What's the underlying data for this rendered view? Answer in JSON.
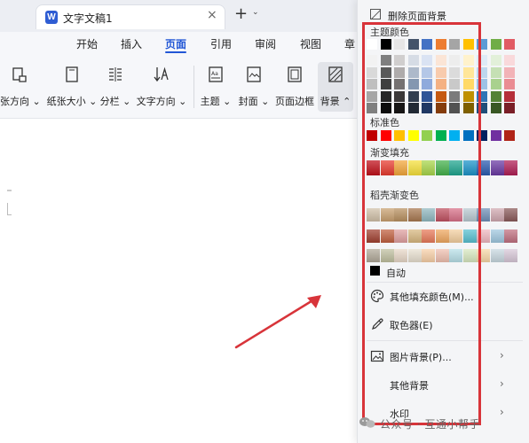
{
  "tab": {
    "title": "文字文稿1",
    "close": "×",
    "add": "+",
    "more": "⌄"
  },
  "menu": {
    "items": [
      "开始",
      "插入",
      "页面",
      "引用",
      "审阅",
      "视图",
      "章"
    ],
    "active_index": 2
  },
  "toolbar": {
    "items": [
      {
        "label": "张方向 ⌄",
        "icon": "page-orientation-icon"
      },
      {
        "label": "纸张大小 ⌄",
        "icon": "paper-size-icon"
      },
      {
        "label": "分栏 ⌄",
        "icon": "columns-icon"
      },
      {
        "label": "文字方向 ⌄",
        "icon": "text-direction-icon"
      },
      {
        "label": "主题 ⌄",
        "icon": "theme-icon"
      },
      {
        "label": "封面 ⌄",
        "icon": "cover-icon"
      },
      {
        "label": "页面边框",
        "icon": "page-border-icon"
      },
      {
        "label": "背景 ⌃",
        "icon": "background-icon"
      },
      {
        "label": "水",
        "icon": "watermark-icon"
      }
    ],
    "corner_mark": "↘"
  },
  "panel": {
    "remove_background": "删除页面背景",
    "theme_colors_title": "主题颜色",
    "standard_colors_title": "标准色",
    "gradient_fill_title": "渐变填充",
    "daoke_gradient_title": "稻壳渐变色",
    "auto_label": "自动",
    "more_fill_colors": "其他填充颜色(M)...",
    "eyedropper": "取色器(E)",
    "picture_background": "图片背景(P)...",
    "other_background": "其他背景",
    "watermark_item": "水印",
    "chevron": "›",
    "theme_top_row": [
      "#ffffff",
      "#000000",
      "#e7e6e6",
      "#44546a",
      "#4472c4",
      "#ed7d31",
      "#a5a5a5",
      "#ffc000",
      "#5b9bd5",
      "#70ad47",
      "#e15b64"
    ],
    "theme_shade_rows": [
      [
        "#f2f2f2",
        "#7f7f7f",
        "#d0cece",
        "#d6dce5",
        "#dae3f3",
        "#fbe5d6",
        "#ededed",
        "#fff2cc",
        "#deebf7",
        "#e2f0d9",
        "#f9d9db"
      ],
      [
        "#d9d9d9",
        "#595959",
        "#aeabab",
        "#adb9ca",
        "#b4c7e7",
        "#f8cbad",
        "#dbdbdb",
        "#ffe699",
        "#bdd7ee",
        "#c5e0b4",
        "#f2b3b7"
      ],
      [
        "#bfbfbf",
        "#3f3f3f",
        "#757171",
        "#8497b0",
        "#8faadc",
        "#f4b183",
        "#c9c9c9",
        "#ffd966",
        "#9dc3e6",
        "#a9d18e",
        "#ea8c93"
      ],
      [
        "#a6a6a6",
        "#262626",
        "#3b3838",
        "#333f50",
        "#2f5597",
        "#c55a11",
        "#7b7b7b",
        "#bf9000",
        "#2e75b6",
        "#548235",
        "#b52f3a"
      ],
      [
        "#7f7f7f",
        "#0d0d0d",
        "#171616",
        "#222a35",
        "#203864",
        "#843c0c",
        "#525252",
        "#7f6000",
        "#1f4e79",
        "#385723",
        "#7a1f27"
      ]
    ],
    "standard_colors": [
      "#c00000",
      "#ff0000",
      "#ffc000",
      "#ffff00",
      "#92d050",
      "#00b050",
      "#00b0f0",
      "#0070c0",
      "#002060",
      "#7030a0",
      "#b02418"
    ],
    "gradient_colors": [
      "#c0101a",
      "#e83b2f",
      "#f4a73a",
      "#f7e13b",
      "#a8d64a",
      "#43b14b",
      "#1fa58f",
      "#1b93c9",
      "#2a5bb0",
      "#6a39a3",
      "#b01e55"
    ],
    "daoke_row1": [
      "#d0c0a8",
      "#c8a070",
      "#b89060",
      "#a87850",
      "#90b8c0",
      "#c05060",
      "#d87088",
      "#b8c8d0",
      "#7090b8",
      "#d0a8b0",
      "#8a5a5a"
    ],
    "daoke_row2": [
      "#a04030",
      "#c06040",
      "#e0a0a0",
      "#d8b880",
      "#e87a5a",
      "#f0a860",
      "#f4d0a0",
      "#58c0d0",
      "#f0b8c0",
      "#a0c8e0",
      "#c07080"
    ],
    "daoke_row3": [
      "#b0a898",
      "#c0c0a0",
      "#e8d8c8",
      "#e8e0d0",
      "#f8d0a8",
      "#f0c0b0",
      "#b8e0e8",
      "#d8e8c0",
      "#f8d8a8",
      "#c8d8e0",
      "#d8c8d8"
    ]
  },
  "watermark_text": "公众号 · 互通小帮手"
}
